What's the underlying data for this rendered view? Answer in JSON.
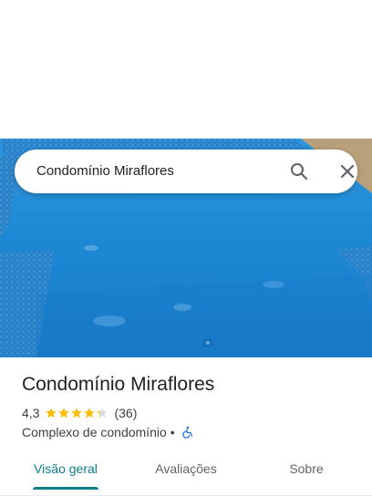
{
  "search": {
    "query": "Condomínio Miraflores",
    "search_icon": "search-icon",
    "close_icon": "close-icon"
  },
  "place": {
    "title": "Condomínio Miraflores",
    "rating": "4,3",
    "rating_value": 4.3,
    "rating_max": 5,
    "review_count": "(36)",
    "category": "Complexo de condomínio",
    "separator": "•",
    "accessibility_icon": "wheelchair-icon"
  },
  "tabs": [
    {
      "label": "Visão geral",
      "selected": true
    },
    {
      "label": "Avaliações",
      "selected": false
    },
    {
      "label": "Sobre",
      "selected": false
    }
  ],
  "colors": {
    "accent": "#0b7d8a",
    "star": "#fbbc04",
    "star_empty": "#dadce0",
    "accessibility": "#1a73e8"
  }
}
